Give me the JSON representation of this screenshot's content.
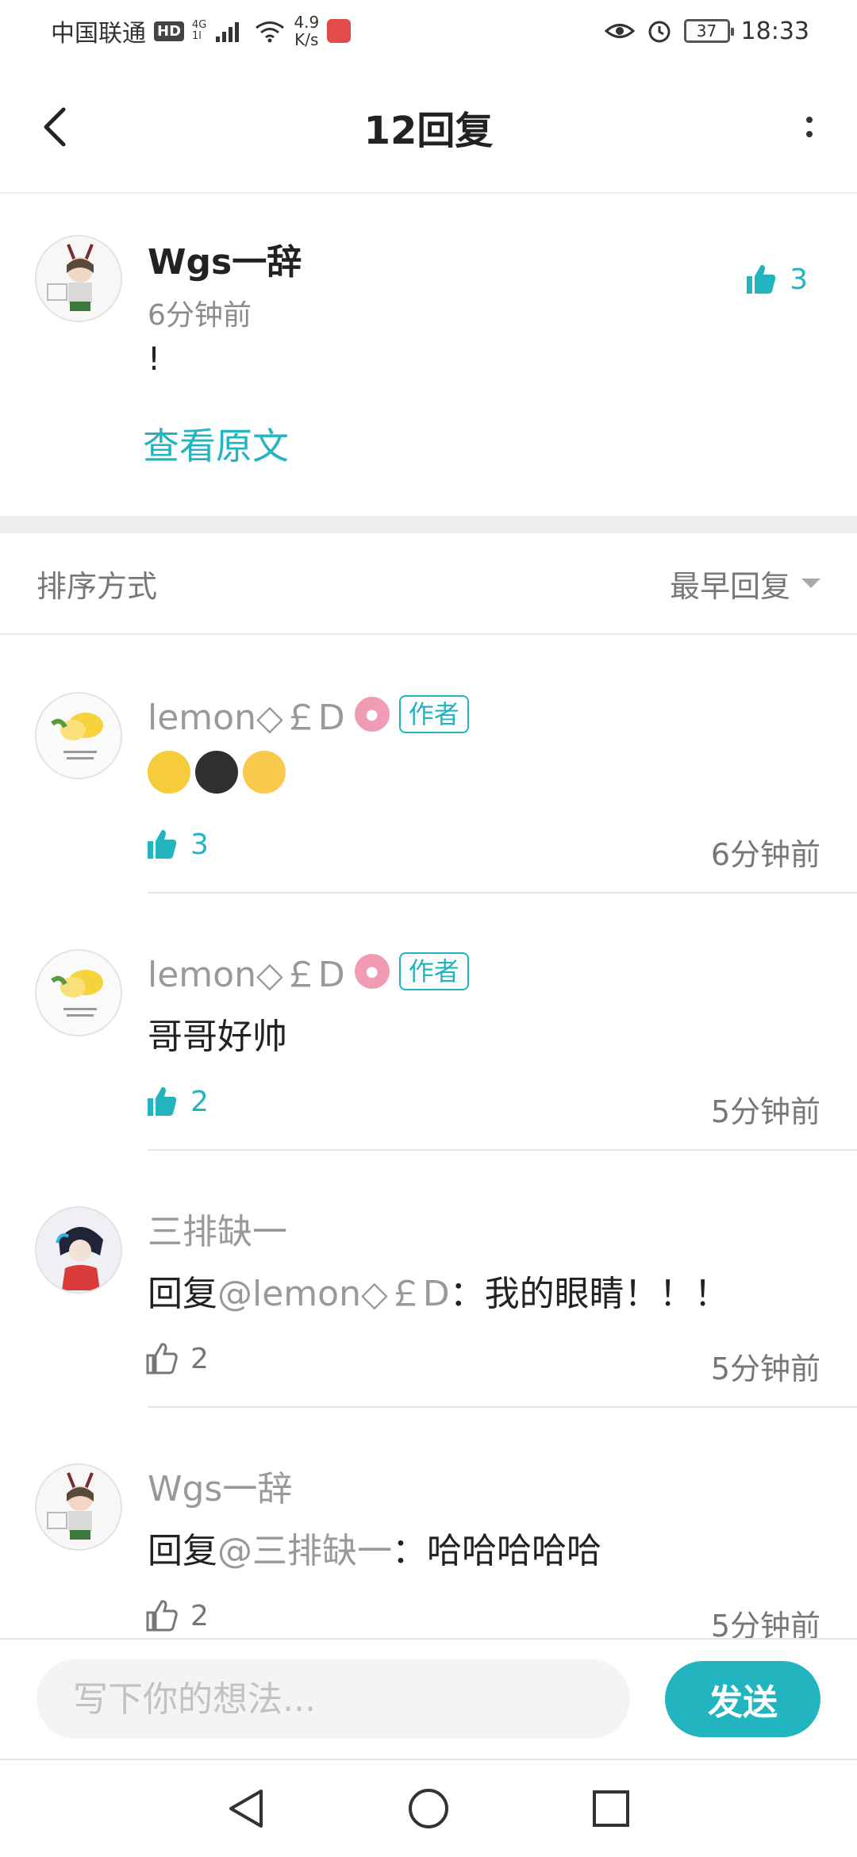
{
  "status_bar": {
    "carrier": "中国联通",
    "hd": "HD",
    "network_top": "4G",
    "network_bottom": "1l",
    "speed_value": "4.9",
    "speed_unit": "K/s",
    "battery": "37",
    "time": "18:33"
  },
  "header": {
    "title": "12回复"
  },
  "original": {
    "username": "Wgs一辞",
    "time": "6分钟前",
    "content": "!",
    "view_original": "查看原文",
    "likes": "3"
  },
  "sort": {
    "label": "排序方式",
    "selected": "最早回复"
  },
  "replies": [
    {
      "username": "lemon◇￡D",
      "is_author": true,
      "author_tag": "作者",
      "content": "",
      "emojis": [
        "smirk-emoji",
        "dark-smirk-emoji",
        "flushed-emoji"
      ],
      "likes": "3",
      "liked": true,
      "time": "6分钟前"
    },
    {
      "username": "lemon◇￡D",
      "is_author": true,
      "author_tag": "作者",
      "content": "哥哥好帅",
      "likes": "2",
      "liked": true,
      "time": "5分钟前"
    },
    {
      "username": "三排缺一",
      "is_author": false,
      "reply_prefix": "回复",
      "mention": "@lemon◇￡D",
      "content": "：我的眼睛！！！",
      "likes": "2",
      "liked": false,
      "time": "5分钟前"
    },
    {
      "username": "Wgs一辞",
      "is_author": false,
      "reply_prefix": "回复",
      "mention": "@三排缺一",
      "content": "：哈哈哈哈哈",
      "likes": "2",
      "liked": false,
      "time": "5分钟前"
    }
  ],
  "composer": {
    "placeholder": "写下你的想法...",
    "send_label": "发送"
  },
  "colors": {
    "accent": "#22b5bf",
    "muted_text": "#999999",
    "divider": "#eeeeee"
  }
}
